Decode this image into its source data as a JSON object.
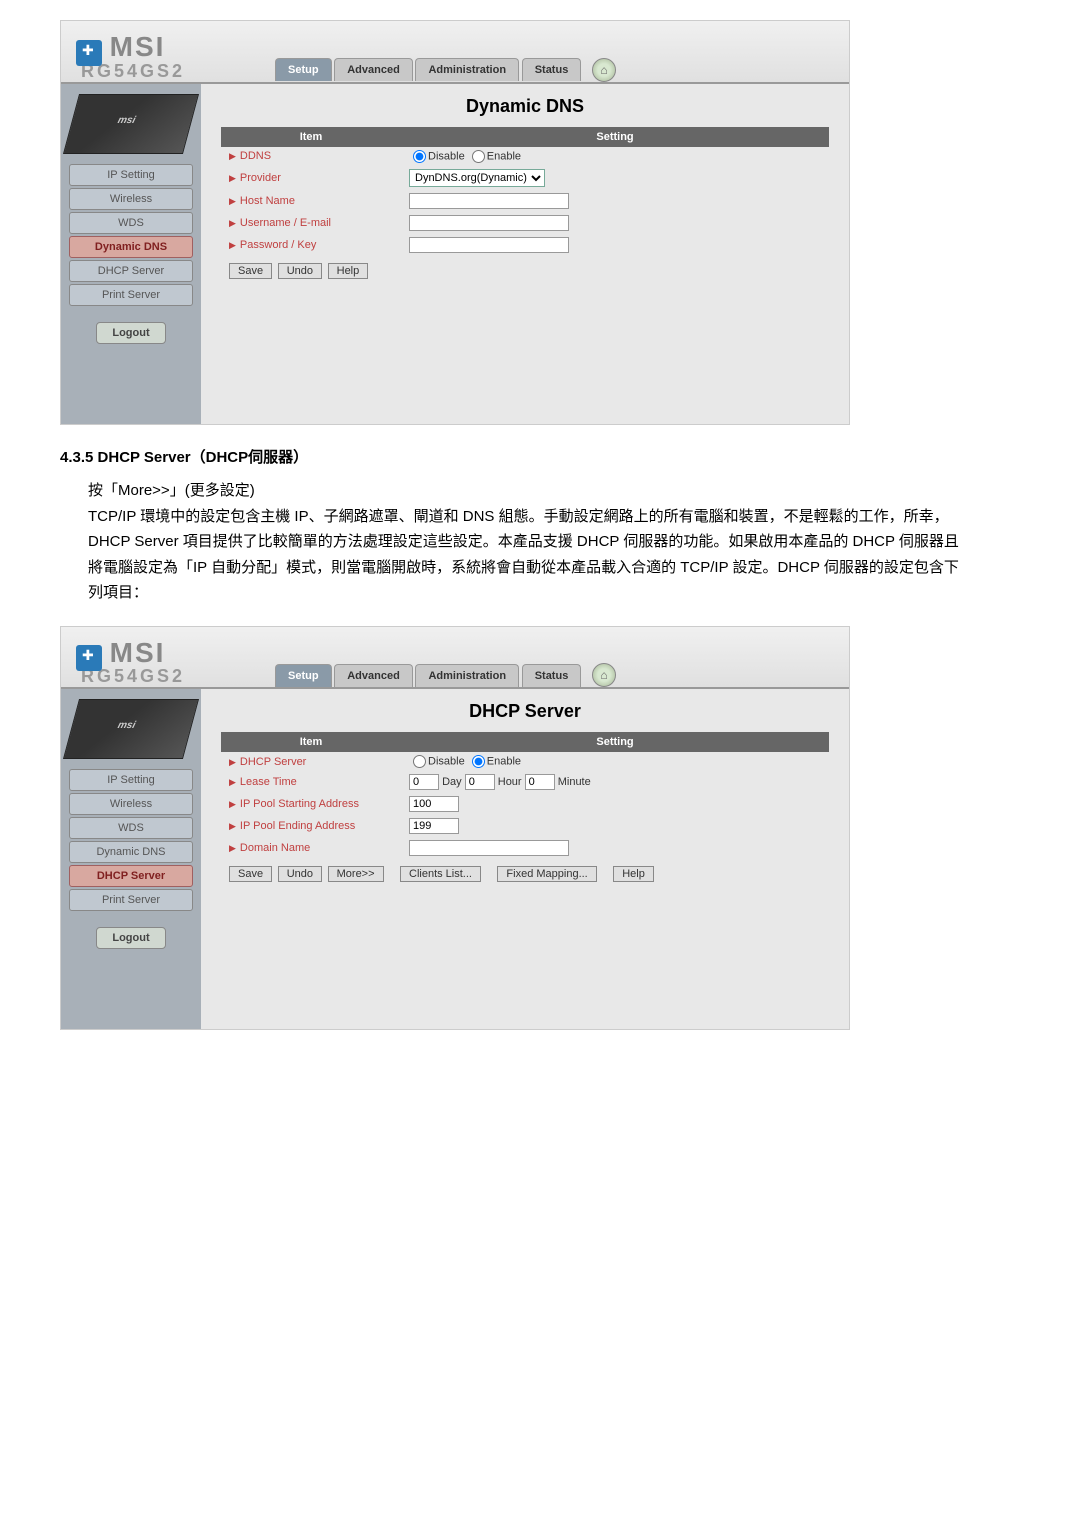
{
  "logo_text": "MSI",
  "model": "RG54GS2",
  "tabs": {
    "setup": "Setup",
    "advanced": "Advanced",
    "administration": "Administration",
    "status": "Status"
  },
  "sidebar": {
    "ip_setting": "IP Setting",
    "wireless": "Wireless",
    "wds": "WDS",
    "dynamic_dns": "Dynamic DNS",
    "dhcp_server": "DHCP Server",
    "print_server": "Print Server",
    "logout": "Logout"
  },
  "ddns": {
    "title": "Dynamic DNS",
    "th_item": "Item",
    "th_setting": "Setting",
    "row_ddns": "DDNS",
    "disable": "Disable",
    "enable": "Enable",
    "row_provider": "Provider",
    "provider_value": "DynDNS.org(Dynamic)",
    "row_hostname": "Host Name",
    "row_username": "Username / E-mail",
    "row_password": "Password / Key",
    "btn_save": "Save",
    "btn_undo": "Undo",
    "btn_help": "Help"
  },
  "section": {
    "heading": "4.3.5 DHCP Server（DHCP伺服器）",
    "line1": "按「More>>」(更多設定)",
    "para": "TCP/IP 環境中的設定包含主機 IP、子網路遮罩、閘道和 DNS 組態。手動設定網路上的所有電腦和裝置，不是輕鬆的工作，所幸，DHCP Server 項目提供了比較簡單的方法處理設定這些設定。本產品支援 DHCP 伺服器的功能。如果啟用本產品的 DHCP 伺服器且將電腦設定為「IP 自動分配」模式，則當電腦開啟時，系統將會自動從本產品載入合適的 TCP/IP 設定。DHCP 伺服器的設定包含下列項目："
  },
  "dhcp": {
    "title": "DHCP Server",
    "th_item": "Item",
    "th_setting": "Setting",
    "row_dhcp": "DHCP Server",
    "disable": "Disable",
    "enable": "Enable",
    "row_lease": "Lease Time",
    "lease_day_val": "0",
    "lease_day": "Day",
    "lease_hour_val": "0",
    "lease_hour": "Hour",
    "lease_min_val": "0",
    "lease_min": "Minute",
    "row_start": "IP Pool Starting Address",
    "start_val": "100",
    "row_end": "IP Pool Ending Address",
    "end_val": "199",
    "row_domain": "Domain Name",
    "btn_save": "Save",
    "btn_undo": "Undo",
    "btn_more": "More>>",
    "btn_clients": "Clients List...",
    "btn_fixed": "Fixed Mapping...",
    "btn_help": "Help"
  }
}
